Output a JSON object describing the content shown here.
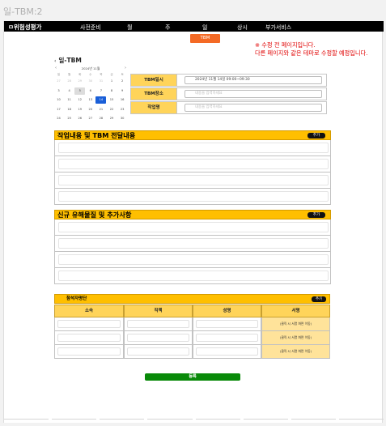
{
  "window_title": "일-TBM:2",
  "topbar": {
    "brand": "ㅁ위험성평가",
    "nav": [
      {
        "label": "사전준비"
      },
      {
        "label": "월"
      },
      {
        "label": "주"
      },
      {
        "label": "일"
      },
      {
        "label": "상시"
      },
      {
        "label": "부가서비스"
      }
    ]
  },
  "tbm_tab": "TBM",
  "notice": {
    "line1": "※ 수정 전 페이지입니다.",
    "line2": "다른 페이지와 같은 테마로 수정할 예정입니다."
  },
  "page_heading": "일-TBM",
  "calendar": {
    "title": "2024년 11월",
    "dow": [
      "일",
      "월",
      "화",
      "수",
      "목",
      "금",
      "토"
    ],
    "weeks": [
      [
        "27",
        "28",
        "29",
        "30",
        "31",
        "1",
        "2"
      ],
      [
        "3",
        "4",
        "5",
        "6",
        "7",
        "8",
        "9"
      ],
      [
        "10",
        "11",
        "12",
        "13",
        "14",
        "15",
        "16"
      ],
      [
        "17",
        "18",
        "19",
        "20",
        "21",
        "22",
        "23"
      ],
      [
        "24",
        "25",
        "26",
        "27",
        "28",
        "29",
        "30"
      ]
    ],
    "today": "5",
    "selected": "14"
  },
  "tbm_form": {
    "date_label": "TBM일시",
    "date_value": "2024년 11월 14일 09:00~09:30",
    "place_label": "TBM장소",
    "place_placeholder": "내용을 입력하세요",
    "worker_label": "작업명",
    "worker_placeholder": "내용을 입력하세요"
  },
  "section_work": {
    "title": "작업내용 및 TBM 전달내용",
    "add_label": "추가"
  },
  "section_hazard": {
    "title": "신규 유해물질 및 추가사항",
    "add_label": "추가"
  },
  "attendees": {
    "title": "참석자명단",
    "add_label": "추가",
    "columns": [
      "소속",
      "직책",
      "성명",
      "서명"
    ],
    "sign_text": "(클릭 시 서명 화면 이동)"
  },
  "submit_label": "등록",
  "colors": {
    "accent_yellow": "#ffbf00",
    "label_yellow": "#ffd45a",
    "tab_orange": "#f46a25",
    "submit_green": "#098a09",
    "selected_blue": "#1a5fd8",
    "notice_red": "#e00000"
  }
}
